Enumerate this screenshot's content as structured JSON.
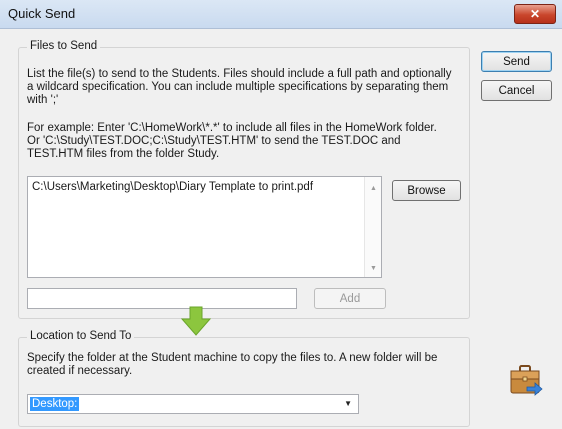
{
  "window": {
    "title": "Quick Send",
    "close_glyph": "✕"
  },
  "files_group": {
    "legend": "Files to Send",
    "description_lines": [
      "List the file(s) to send to the Students. Files should include a full path and optionally",
      "a wildcard specification. You can include multiple specifications by separating them",
      "with ';'"
    ],
    "example_lines": [
      "For example: Enter 'C:\\HomeWork\\*.*' to include all files in the HomeWork folder.",
      "Or 'C:\\Study\\TEST.DOC;C:\\Study\\TEST.HTM' to send the TEST.DOC and",
      "TEST.HTM files from the folder Study."
    ],
    "files": [
      "C:\\Users\\Marketing\\Desktop\\Diary Template to print.pdf"
    ],
    "browse_label": "Browse",
    "add_input_value": "",
    "add_label": "Add",
    "scroll_up_glyph": "▲",
    "scroll_down_glyph": "▼"
  },
  "location_group": {
    "legend": "Location to Send To",
    "description_lines": [
      "Specify the folder at the Student machine to copy the files to. A new folder will be",
      "created if necessary."
    ],
    "selected_folder": "Desktop:",
    "dropdown_glyph": "▼"
  },
  "buttons": {
    "send": "Send",
    "cancel": "Cancel"
  },
  "icons": {
    "down_arrow": "green-down-arrow-icon",
    "send_briefcase": "briefcase-send-icon"
  },
  "colors": {
    "arrow_green": "#8cc63e",
    "selection_blue": "#3399ff",
    "close_red": "#c9462c"
  }
}
